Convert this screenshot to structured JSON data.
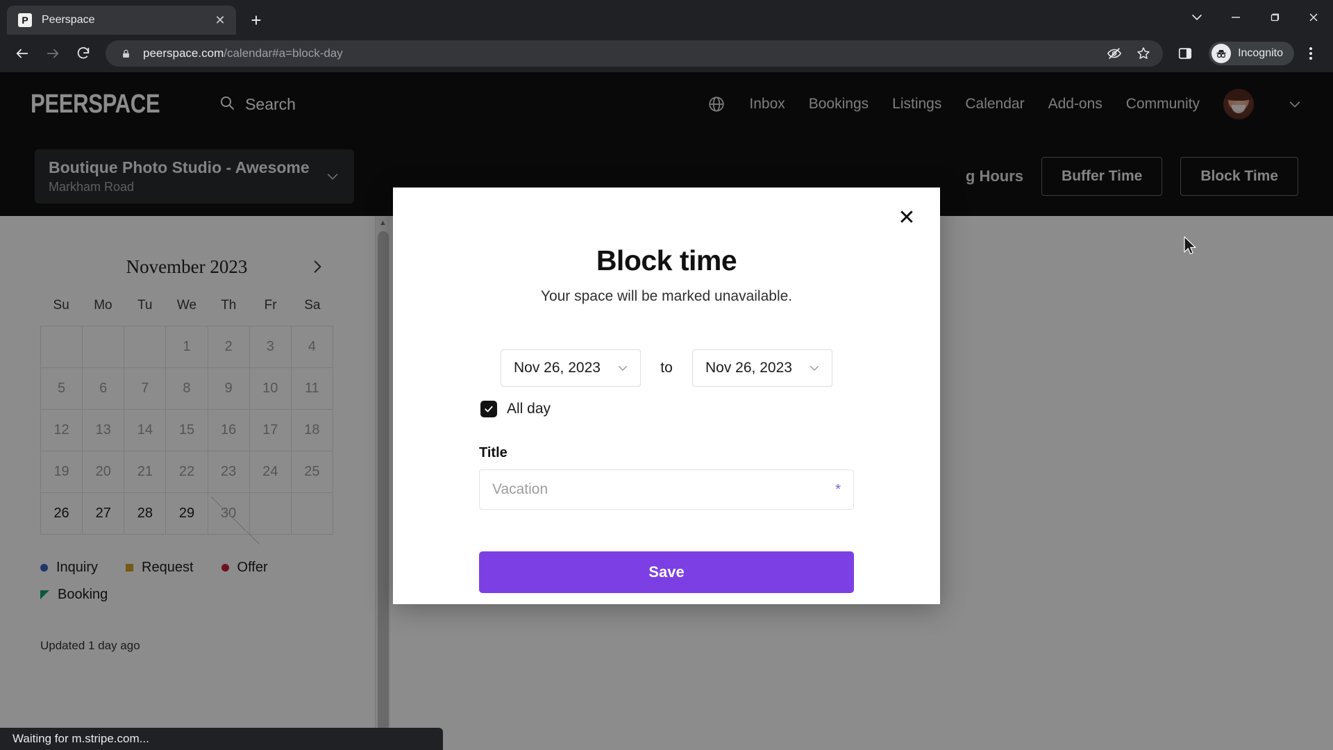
{
  "browser": {
    "tab": {
      "title": "Peerspace",
      "favicon_letter": "P",
      "close_icon": "close-icon"
    },
    "new_tab_label": "+",
    "window_controls": [
      "minimize-group-icon",
      "minimize-icon",
      "maximize-icon",
      "close-window-icon"
    ],
    "nav": {
      "back": "back-icon",
      "forward": "forward-icon",
      "reload": "reload-icon"
    },
    "omnibox": {
      "lock_icon": "lock-icon",
      "url_host": "peerspace.com",
      "url_path": "/calendar#a=block-day",
      "full_url": "peerspace.com/calendar#a=block-day"
    },
    "omni_actions": [
      "eye-slash-icon",
      "bookmark-star-icon",
      "side-panel-icon"
    ],
    "incognito_label": "Incognito",
    "menu_icon": "three-dot-menu-icon",
    "status_message": "Waiting for m.stripe.com..."
  },
  "site_header": {
    "logo": "PEERSPACE",
    "search_label": "Search",
    "globe_icon": "globe-icon",
    "nav_items": [
      {
        "label": "Inbox"
      },
      {
        "label": "Bookings"
      },
      {
        "label": "Listings"
      },
      {
        "label": "Calendar"
      },
      {
        "label": "Add-ons"
      },
      {
        "label": "Community"
      }
    ],
    "avatar": "user-avatar",
    "account_chevron": "chevron-down-icon"
  },
  "listing_bar": {
    "listing_name": "Boutique Photo Studio - Awesome",
    "listing_address": "Markham Road",
    "listing_chevron": "chevron-down-icon",
    "operating_hours_label": "g Hours",
    "buffer_time_label": "Buffer Time",
    "block_time_label": "Block Time"
  },
  "calendar": {
    "month_label": "November 2023",
    "next_month_icon": "chevron-right-icon",
    "day_headers": [
      "Su",
      "Mo",
      "Tu",
      "We",
      "Th",
      "Fr",
      "Sa"
    ],
    "weeks": [
      [
        {
          "day": "",
          "state": "empty"
        },
        {
          "day": "",
          "state": "empty"
        },
        {
          "day": "",
          "state": "empty"
        },
        {
          "day": "1",
          "state": "past"
        },
        {
          "day": "2",
          "state": "past"
        },
        {
          "day": "3",
          "state": "past"
        },
        {
          "day": "4",
          "state": "past"
        }
      ],
      [
        {
          "day": "5",
          "state": "past"
        },
        {
          "day": "6",
          "state": "past"
        },
        {
          "day": "7",
          "state": "past"
        },
        {
          "day": "8",
          "state": "past"
        },
        {
          "day": "9",
          "state": "past"
        },
        {
          "day": "10",
          "state": "past"
        },
        {
          "day": "11",
          "state": "past"
        }
      ],
      [
        {
          "day": "12",
          "state": "past"
        },
        {
          "day": "13",
          "state": "past"
        },
        {
          "day": "14",
          "state": "past"
        },
        {
          "day": "15",
          "state": "past"
        },
        {
          "day": "16",
          "state": "past"
        },
        {
          "day": "17",
          "state": "past"
        },
        {
          "day": "18",
          "state": "past"
        }
      ],
      [
        {
          "day": "19",
          "state": "past"
        },
        {
          "day": "20",
          "state": "past"
        },
        {
          "day": "21",
          "state": "past"
        },
        {
          "day": "22",
          "state": "past"
        },
        {
          "day": "23",
          "state": "past"
        },
        {
          "day": "24",
          "state": "past"
        },
        {
          "day": "25",
          "state": "past"
        }
      ],
      [
        {
          "day": "26",
          "state": "current"
        },
        {
          "day": "27",
          "state": "current"
        },
        {
          "day": "28",
          "state": "current"
        },
        {
          "day": "29",
          "state": "current"
        },
        {
          "day": "30",
          "state": "slash"
        },
        {
          "day": "",
          "state": "empty"
        },
        {
          "day": "",
          "state": "empty"
        }
      ]
    ],
    "legend": [
      {
        "label": "Inquiry",
        "marker": "dot",
        "color": "#3b63c4"
      },
      {
        "label": "Request",
        "marker": "square",
        "color": "#d4a52b"
      },
      {
        "label": "Offer",
        "marker": "dot",
        "color": "#cc1f3c"
      },
      {
        "label": "Booking",
        "marker": "triangle",
        "color": "#0fa36b"
      }
    ],
    "updated_text": "Updated 1 day ago"
  },
  "modal": {
    "close_icon": "close-icon",
    "title": "Block time",
    "subtitle": "Your space will be marked unavailable.",
    "start_date": "Nov 26, 2023",
    "end_date": "Nov 26, 2023",
    "to_label": "to",
    "date_chevron": "chevron-down-icon",
    "all_day_label": "All day",
    "all_day_checked": true,
    "check_icon": "check-icon",
    "title_field_label": "Title",
    "title_field_value": "",
    "title_field_placeholder": "Vacation",
    "required_marker": "*",
    "save_label": "Save",
    "accent_color": "#7c3fe4"
  }
}
